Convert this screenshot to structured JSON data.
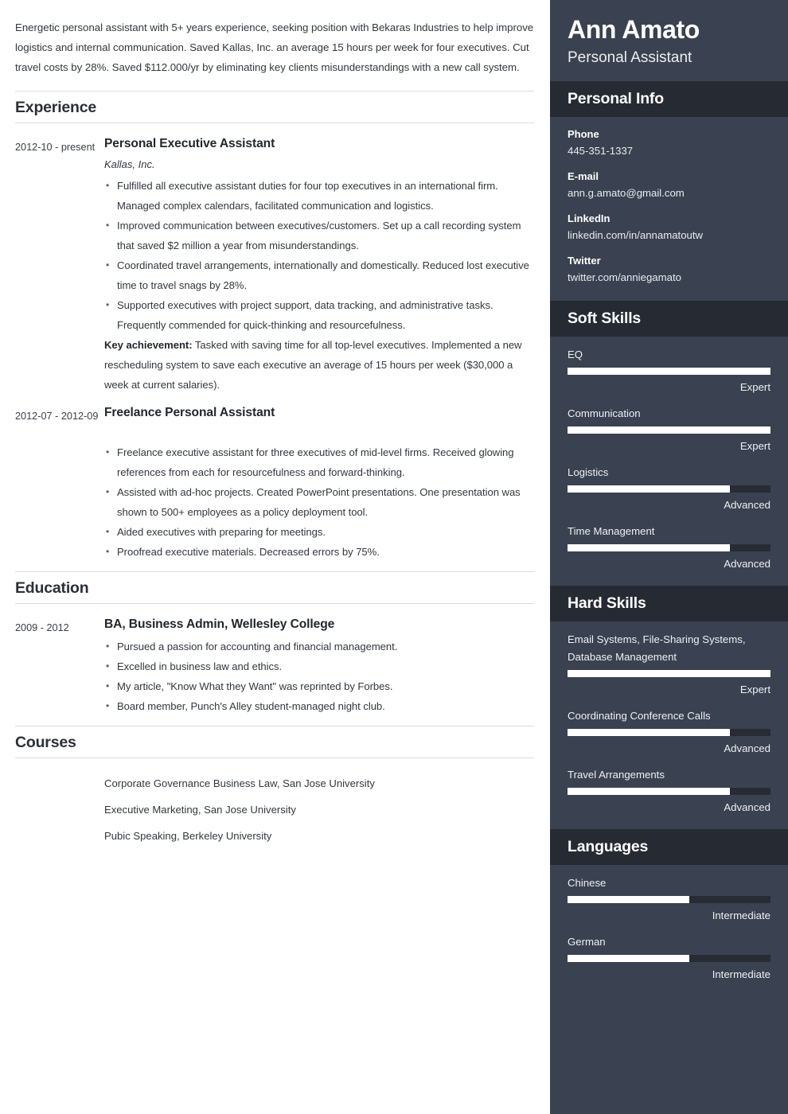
{
  "main": {
    "summary": "Energetic personal assistant with 5+ years experience, seeking position with Bekaras Industries to help improve logistics and internal communication. Saved Kallas, Inc. an average 15 hours per week for four executives. Cut travel costs by 28%. Saved $112.000/yr by eliminating key clients misunderstandings with a new call system.",
    "sections": {
      "experience_title": "Experience",
      "education_title": "Education",
      "courses_title": "Courses"
    },
    "experience": [
      {
        "dates": "2012-10 - present",
        "title": "Personal Executive Assistant",
        "org": "Kallas, Inc.",
        "bullets": [
          "Fulfilled all executive assistant duties for four top executives in an international firm. Managed complex calendars, facilitated communication and logistics.",
          "Improved communication between executives/customers. Set up a call recording system that saved $2 million a year from misunderstandings.",
          "Coordinated travel arrangements, internationally and domestically. Reduced lost executive time to travel snags by 28%.",
          "Supported executives with project support, data tracking, and administrative tasks. Frequently commended for quick-thinking and resourcefulness."
        ],
        "key_achievement_label": "Key achievement:",
        "key_achievement_text": " Tasked with saving time for all top-level executives. Implemented a new rescheduling system to save each executive an average of 15 hours per week ($30,000 a week at current salaries)."
      },
      {
        "dates": "2012-07 - 2012-09",
        "title": "Freelance Personal Assistant",
        "org": "",
        "bullets": [
          "Freelance executive assistant for three executives of mid-level firms. Received glowing references from each for resourcefulness and forward-thinking.",
          "Assisted with ad-hoc projects. Created PowerPoint presentations. One presentation was shown to 500+ employees as a policy deployment tool.",
          "Aided executives with preparing for meetings.",
          "Proofread executive materials. Decreased errors by 75%."
        ]
      }
    ],
    "education": [
      {
        "dates": "2009 - 2012",
        "title": "BA, Business Admin, Wellesley College",
        "bullets": [
          "Pursued a passion for accounting and financial management.",
          "Excelled in business law and ethics.",
          "My article, \"Know What they Want\" was reprinted by Forbes.",
          "Board member, Punch's Alley student-managed night club."
        ]
      }
    ],
    "courses": [
      "Corporate Governance Business Law, San Jose University",
      "Executive Marketing, San Jose University",
      "Pubic Speaking, Berkeley University"
    ]
  },
  "sidebar": {
    "name": "Ann Amato",
    "role": "Personal Assistant",
    "personal_info": {
      "heading": "Personal Info",
      "items": [
        {
          "label": "Phone",
          "value": "445-351-1337"
        },
        {
          "label": "E-mail",
          "value": "ann.g.amato@gmail.com"
        },
        {
          "label": "LinkedIn",
          "value": "linkedin.com/in/annamatoutw"
        },
        {
          "label": "Twitter",
          "value": "twitter.com/anniegamato"
        }
      ]
    },
    "soft_skills": {
      "heading": "Soft Skills",
      "items": [
        {
          "name": "EQ",
          "level": "Expert",
          "percent": 100
        },
        {
          "name": "Communication",
          "level": "Expert",
          "percent": 100
        },
        {
          "name": "Logistics",
          "level": "Advanced",
          "percent": 80
        },
        {
          "name": "Time Management",
          "level": "Advanced",
          "percent": 80
        }
      ]
    },
    "hard_skills": {
      "heading": "Hard Skills",
      "items": [
        {
          "name": "Email Systems, File-Sharing Systems, Database Management",
          "level": "Expert",
          "percent": 100
        },
        {
          "name": "Coordinating Conference Calls",
          "level": "Advanced",
          "percent": 80
        },
        {
          "name": "Travel Arrangements",
          "level": "Advanced",
          "percent": 80
        }
      ]
    },
    "languages": {
      "heading": "Languages",
      "items": [
        {
          "name": "Chinese",
          "level": "Intermediate",
          "percent": 60
        },
        {
          "name": "German",
          "level": "Intermediate",
          "percent": 60
        }
      ]
    },
    "colors": {
      "sidebar_bg": "#3a4150",
      "band_bg": "#262a33",
      "bar_fill": "#ffffff",
      "bar_track": "#272b34"
    }
  }
}
